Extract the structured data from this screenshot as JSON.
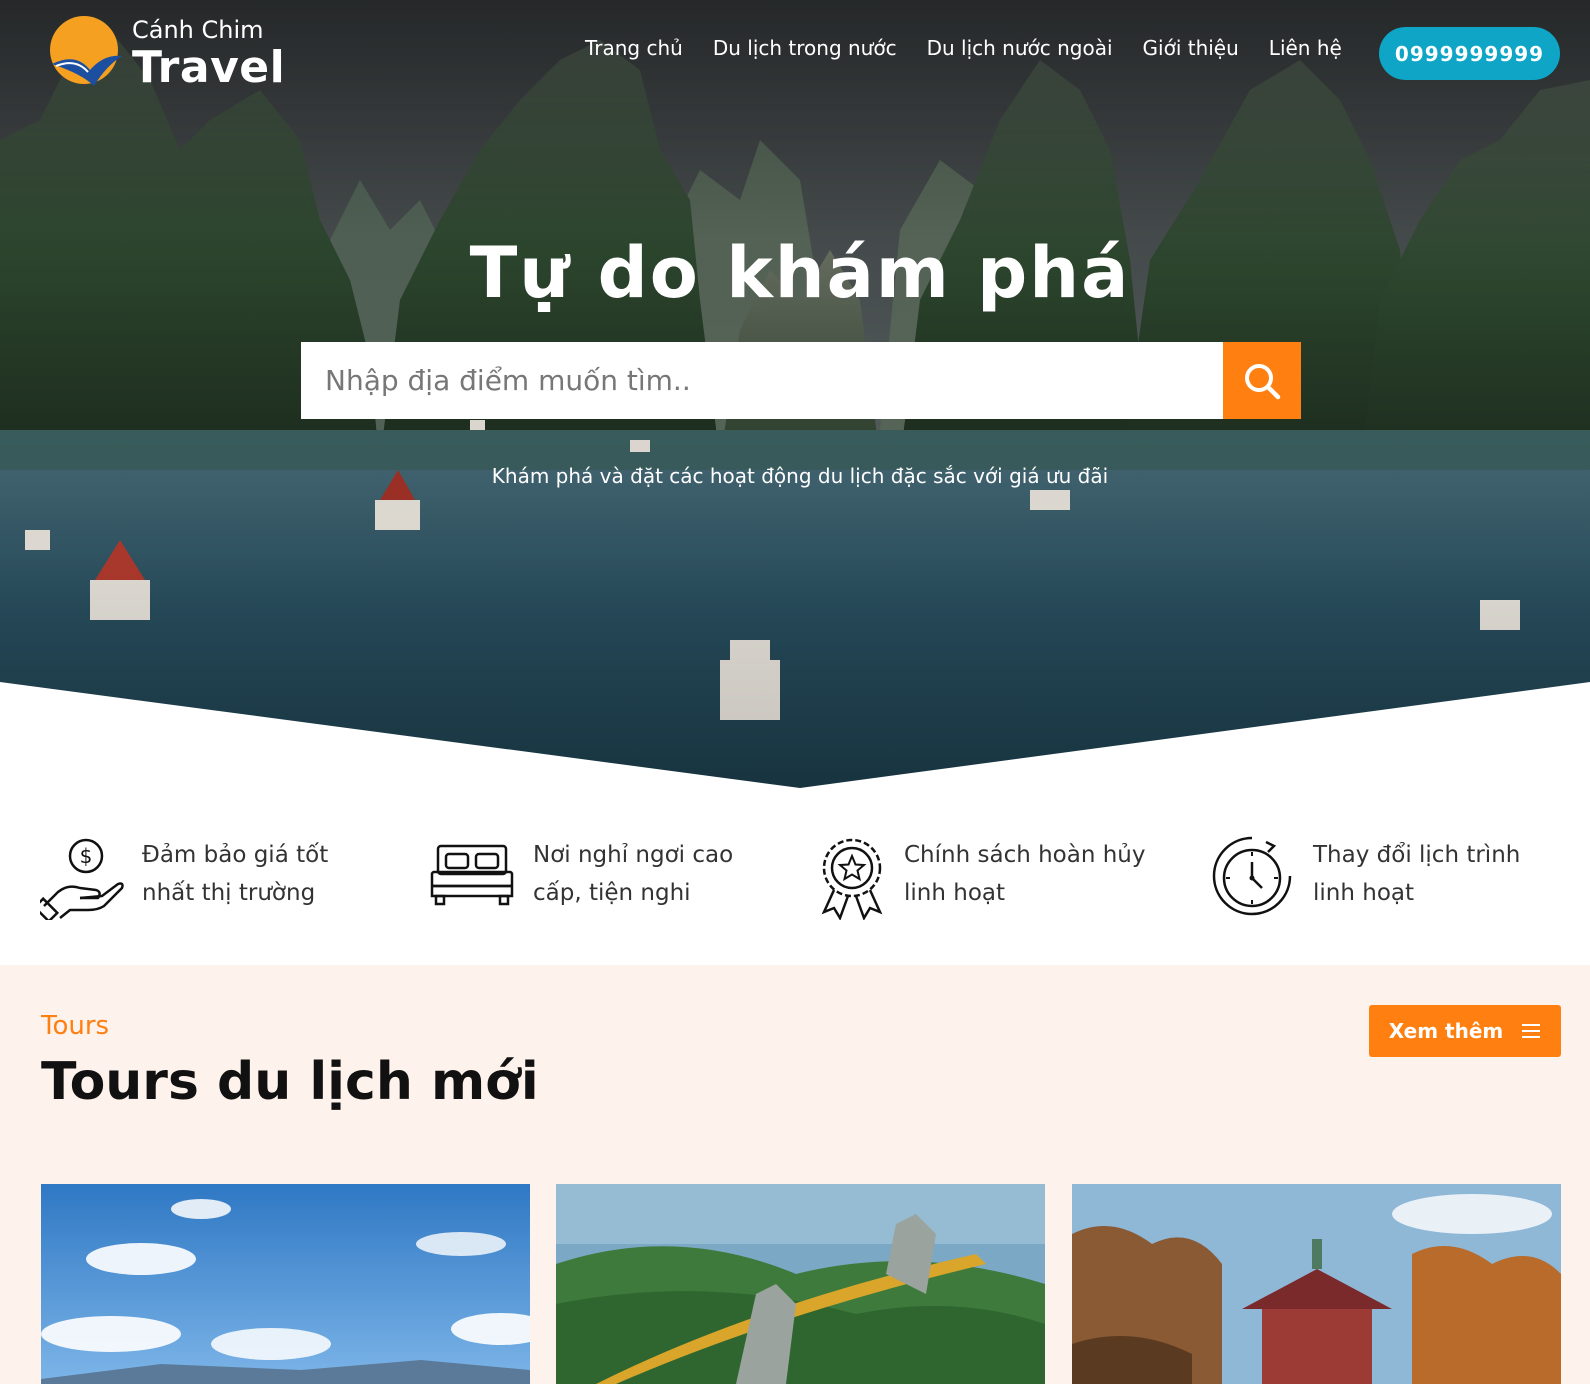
{
  "header": {
    "logo_small": "Cánh Chim",
    "logo_big": "Travel",
    "nav": [
      "Trang chủ",
      "Du lịch trong nước",
      "Du lịch nước ngoài",
      "Giới thiệu",
      "Liên hệ"
    ],
    "phone": "0999999999"
  },
  "hero": {
    "title": "Tự do khám phá",
    "search_placeholder": "Nhập địa điểm muốn tìm..",
    "subtitle": "Khám phá và đặt các hoạt động du lịch đặc sắc với giá ưu đãi"
  },
  "features": [
    {
      "icon": "hand-coin-icon",
      "line1": "Đảm bảo giá tốt",
      "line2": "nhất thị trường"
    },
    {
      "icon": "bed-icon",
      "line1": "Nơi nghỉ ngơi cao",
      "line2": "cấp, tiện nghi"
    },
    {
      "icon": "award-badge-icon",
      "line1": "Chính sách hoàn hủy",
      "line2": "linh hoạt"
    },
    {
      "icon": "clock-refresh-icon",
      "line1": "Thay đổi lịch trình",
      "line2": "linh hoạt"
    }
  ],
  "tours": {
    "kicker": "Tours",
    "title": "Tours du lịch mới",
    "more_label": "Xem thêm"
  },
  "colors": {
    "accent": "#ff7f11",
    "phone_button": "#0ea5c6",
    "tours_bg": "#fdf2ec"
  }
}
